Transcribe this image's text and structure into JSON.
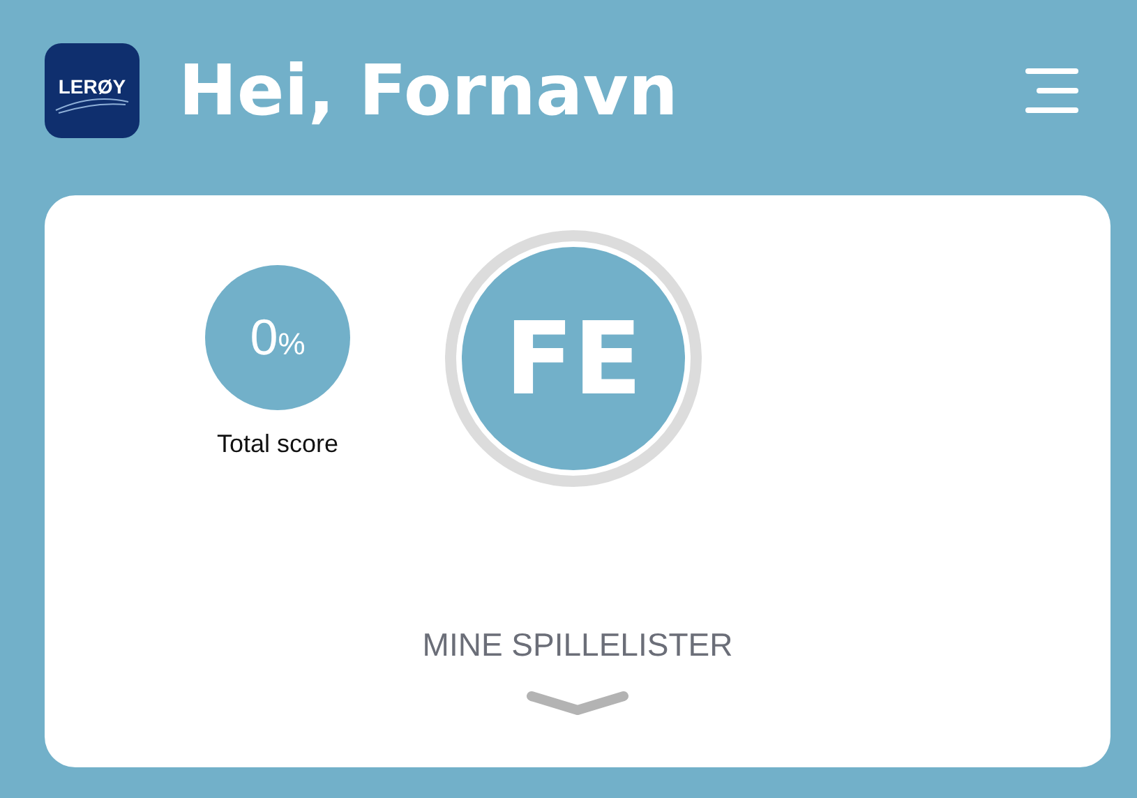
{
  "header": {
    "logo_text": "LERØY",
    "greeting": "Hei, Fornavn"
  },
  "profile": {
    "score_value": "0",
    "score_unit": "%",
    "score_label": "Total score",
    "initials": "FE"
  },
  "playlists": {
    "title": "MINE SPILLELISTER"
  }
}
